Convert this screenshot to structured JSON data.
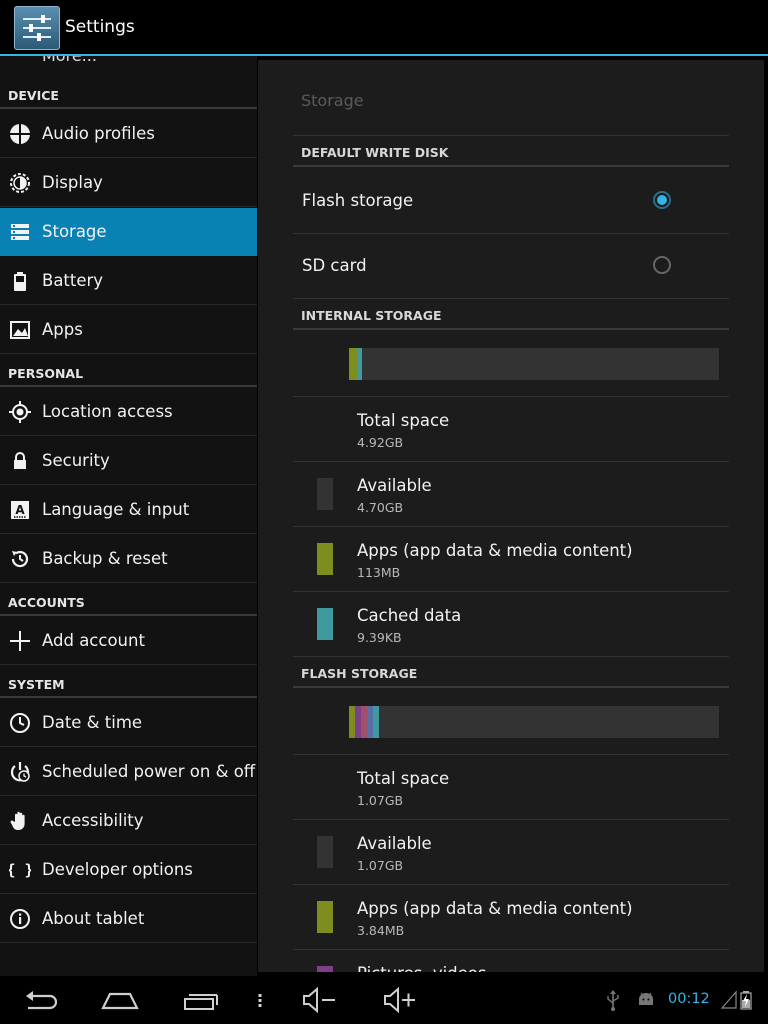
{
  "app": {
    "title": "Settings"
  },
  "sidebar": {
    "cut_item": "More...",
    "sections": [
      {
        "header": "DEVICE"
      },
      {
        "header": "PERSONAL"
      },
      {
        "header": "ACCOUNTS"
      },
      {
        "header": "SYSTEM"
      }
    ],
    "items": [
      {
        "label": "Audio profiles",
        "icon": "audio-profiles-icon"
      },
      {
        "label": "Display",
        "icon": "display-brightness-icon"
      },
      {
        "label": "Storage",
        "icon": "storage-icon",
        "selected": true
      },
      {
        "label": "Battery",
        "icon": "battery-icon"
      },
      {
        "label": "Apps",
        "icon": "apps-icon"
      },
      {
        "label": "Location access",
        "icon": "location-icon"
      },
      {
        "label": "Security",
        "icon": "lock-icon"
      },
      {
        "label": "Language & input",
        "icon": "keyboard-a-icon"
      },
      {
        "label": "Backup & reset",
        "icon": "backup-icon"
      },
      {
        "label": "Add account",
        "icon": "plus-icon"
      },
      {
        "label": "Date & time",
        "icon": "clock-icon"
      },
      {
        "label": "Scheduled power on & off",
        "icon": "power-clock-icon"
      },
      {
        "label": "Accessibility",
        "icon": "hand-icon"
      },
      {
        "label": "Developer options",
        "icon": "braces-icon"
      },
      {
        "label": "About tablet",
        "icon": "info-icon"
      }
    ]
  },
  "panel": {
    "title": "Storage",
    "default_write_disk": {
      "header": "DEFAULT WRITE DISK",
      "options": [
        {
          "label": "Flash storage",
          "selected": true
        },
        {
          "label": "SD card",
          "selected": false
        }
      ]
    },
    "internal_storage": {
      "header": "INTERNAL STORAGE",
      "bar_segments": [
        {
          "color": "#7f8c1f",
          "fraction": 0.022
        },
        {
          "color": "#3f9aa0",
          "fraction": 0.013
        }
      ],
      "rows": [
        {
          "label": "Total space",
          "value": "4.92GB",
          "swatch": null
        },
        {
          "label": "Available",
          "value": "4.70GB",
          "swatch": "#333333"
        },
        {
          "label": "Apps (app data & media content)",
          "value": "113MB",
          "swatch": "#7f8c1f"
        },
        {
          "label": "Cached data",
          "value": "9.39KB",
          "swatch": "#3f9aa0"
        }
      ]
    },
    "flash_storage": {
      "header": "FLASH STORAGE",
      "bar_segments": [
        {
          "color": "#7f8c1f",
          "fraction": 0.016
        },
        {
          "color": "#7d3f86",
          "fraction": 0.016
        },
        {
          "color": "#a0506a",
          "fraction": 0.016
        },
        {
          "color": "#5a6fa8",
          "fraction": 0.016
        },
        {
          "color": "#3f9aa0",
          "fraction": 0.016
        }
      ],
      "rows": [
        {
          "label": "Total space",
          "value": "1.07GB",
          "swatch": null
        },
        {
          "label": "Available",
          "value": "1.07GB",
          "swatch": "#333333"
        },
        {
          "label": "Apps (app data & media content)",
          "value": "3.84MB",
          "swatch": "#7f8c1f"
        }
      ],
      "cut_row": {
        "label": "Pictures, videos",
        "swatch": "#7d3f86"
      }
    }
  },
  "navbar": {
    "clock": "00:12",
    "icons": [
      "back-icon",
      "home-icon",
      "recents-icon",
      "menu-icon",
      "volume-down-icon",
      "volume-up-icon",
      "usb-icon",
      "android-icon",
      "signal-icon",
      "battery-charging-icon"
    ]
  },
  "colors": {
    "accent": "#33b5e5",
    "selected_bg": "#0a81b4"
  }
}
